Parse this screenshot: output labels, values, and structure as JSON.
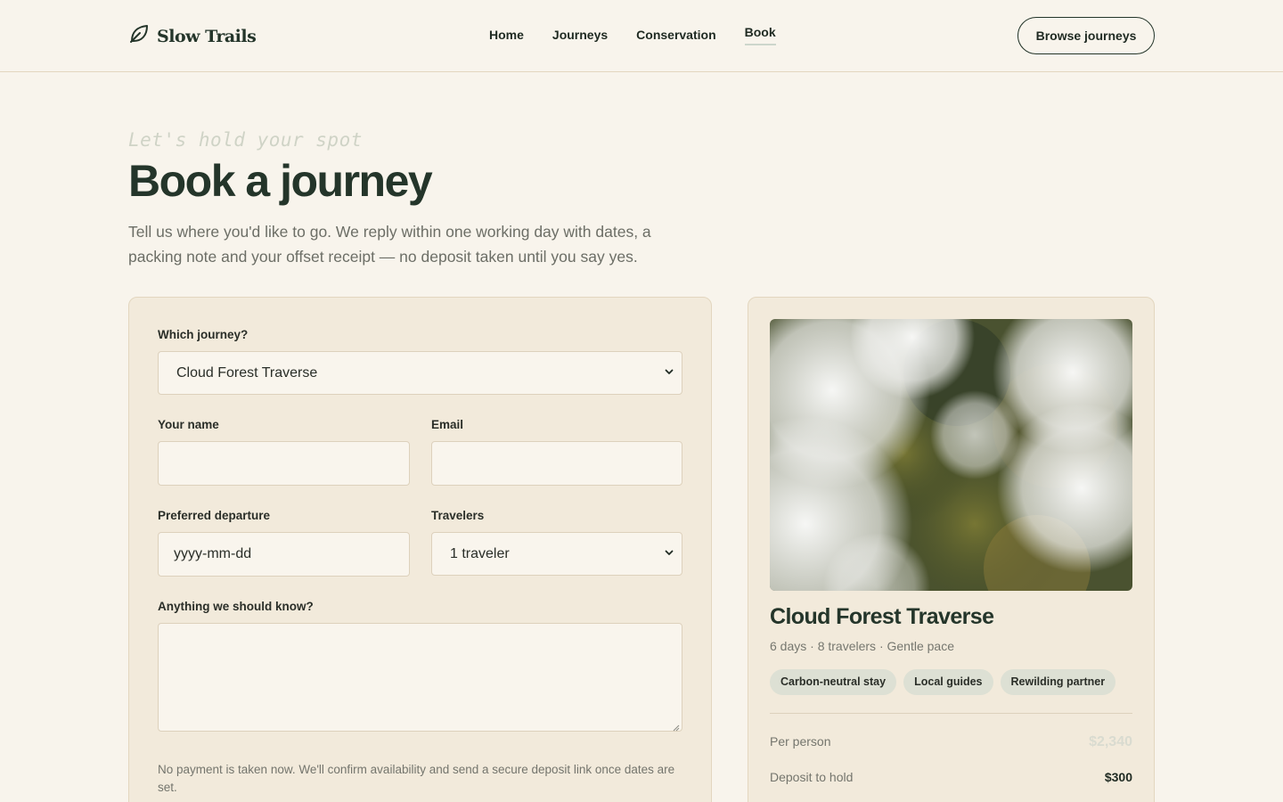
{
  "brand": {
    "name": "Slow Trails"
  },
  "nav": {
    "items": [
      {
        "label": "Home"
      },
      {
        "label": "Journeys"
      },
      {
        "label": "Conservation"
      },
      {
        "label": "Book",
        "active": true
      }
    ],
    "cta": "Browse journeys"
  },
  "hero": {
    "eyebrow": "Let's hold your spot",
    "title": "Book a journey",
    "intro": "Tell us where you'd like to go. We reply within one working day with dates, a packing note and your offset receipt — no deposit taken until you say yes."
  },
  "form": {
    "journey_label": "Which journey?",
    "journey_value": "Cloud Forest Traverse",
    "name_label": "Your name",
    "name_value": "",
    "email_label": "Email",
    "email_value": "",
    "departure_label": "Preferred departure",
    "departure_placeholder": "yyyy-mm-dd",
    "travelers_label": "Travelers",
    "travelers_value": "1 traveler",
    "notes_label": "Anything we should know?",
    "notes_value": "",
    "note": "No payment is taken now. We'll confirm availability and send a secure deposit link once dates are set."
  },
  "summary": {
    "title": "Cloud Forest Traverse",
    "meta": "6 days · 8 travelers · Gentle pace",
    "tags": [
      "Carbon-neutral stay",
      "Local guides",
      "Rewilding partner"
    ],
    "rows": [
      {
        "key": "Per person",
        "value": "$2,340"
      },
      {
        "key": "Deposit to hold",
        "value": "$300"
      }
    ]
  },
  "colors": {
    "background": "#f8f4ec",
    "card": "#f2eadb",
    "accent": "#24352a",
    "tag": "#dde0d4"
  }
}
